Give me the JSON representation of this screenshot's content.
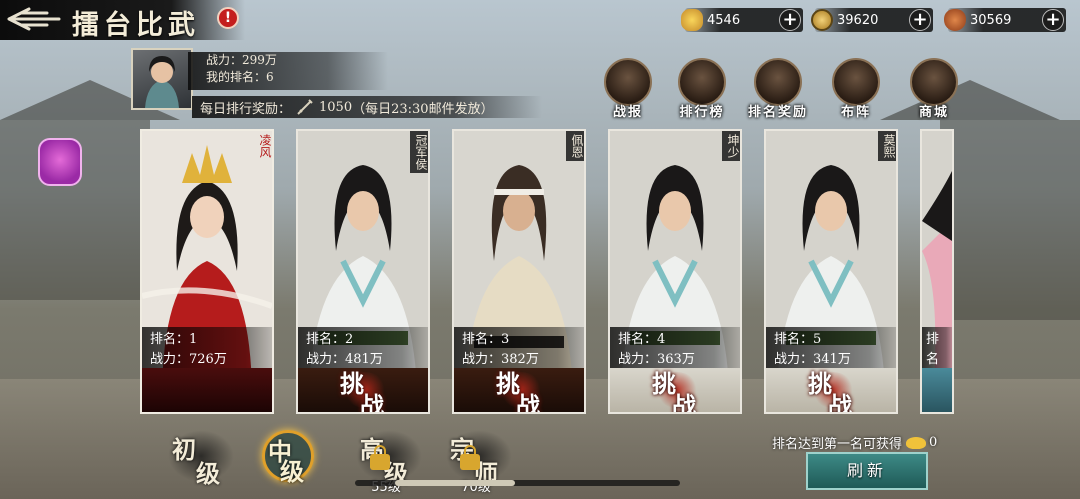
{
  "header": {
    "title": "擂台比武",
    "back_icon": "back-arrow-icon",
    "alert_icon": "!"
  },
  "currencies": [
    {
      "icon": "gold-ingot-icon",
      "value": "4546",
      "plus": "+"
    },
    {
      "icon": "copper-coin-icon",
      "value": "39620",
      "plus": "+"
    },
    {
      "icon": "money-bag-icon",
      "value": "30569",
      "plus": "+"
    }
  ],
  "player": {
    "power_line": "战力：299万",
    "rank_line": "我的排名：6"
  },
  "daily_reward": {
    "label": "每日排行奖励：",
    "amount": "1050",
    "note": "（每日23:30邮件发放）"
  },
  "actions": [
    {
      "label": "战报",
      "icon": "battle-report-icon"
    },
    {
      "label": "排行榜",
      "icon": "leaderboard-icon"
    },
    {
      "label": "排名奖励",
      "icon": "rank-reward-icon"
    },
    {
      "label": "布阵",
      "icon": "formation-icon"
    },
    {
      "label": "商城",
      "icon": "shop-icon"
    }
  ],
  "cards": [
    {
      "name": "凌风",
      "rank": "排名：1",
      "power": "战力：726万",
      "challenge": false
    },
    {
      "name": "冠军侯",
      "rank": "排名：2",
      "power": "战力：481万",
      "challenge": true
    },
    {
      "name": "佩恩",
      "rank": "排名：3",
      "power": "战力：382万",
      "challenge": true
    },
    {
      "name": "坤少",
      "rank": "排名：4",
      "power": "战力：363万",
      "challenge": true
    },
    {
      "name": "莫熙",
      "rank": "排名：5",
      "power": "战力：341万",
      "challenge": true
    },
    {
      "name": "",
      "rank": "排名",
      "power": "战力",
      "challenge": false
    }
  ],
  "challenge_label": {
    "c1": "挑",
    "c2": "战"
  },
  "tiers": [
    {
      "c1": "初",
      "c2": "级",
      "locked": false,
      "active": false,
      "req": ""
    },
    {
      "c1": "中",
      "c2": "级",
      "locked": false,
      "active": true,
      "req": ""
    },
    {
      "c1": "高",
      "c2": "级",
      "locked": true,
      "active": false,
      "req": "55级"
    },
    {
      "c1": "宗",
      "c2": "师",
      "locked": true,
      "active": false,
      "req": "70级"
    }
  ],
  "rank_note": {
    "text": "排名达到第一名可获得",
    "value": "0"
  },
  "refresh_label": "刷新",
  "colors": {
    "accent_gold": "#e0a02a",
    "refresh_teal": "#2f7470",
    "challenge_red": "#b4281b"
  }
}
